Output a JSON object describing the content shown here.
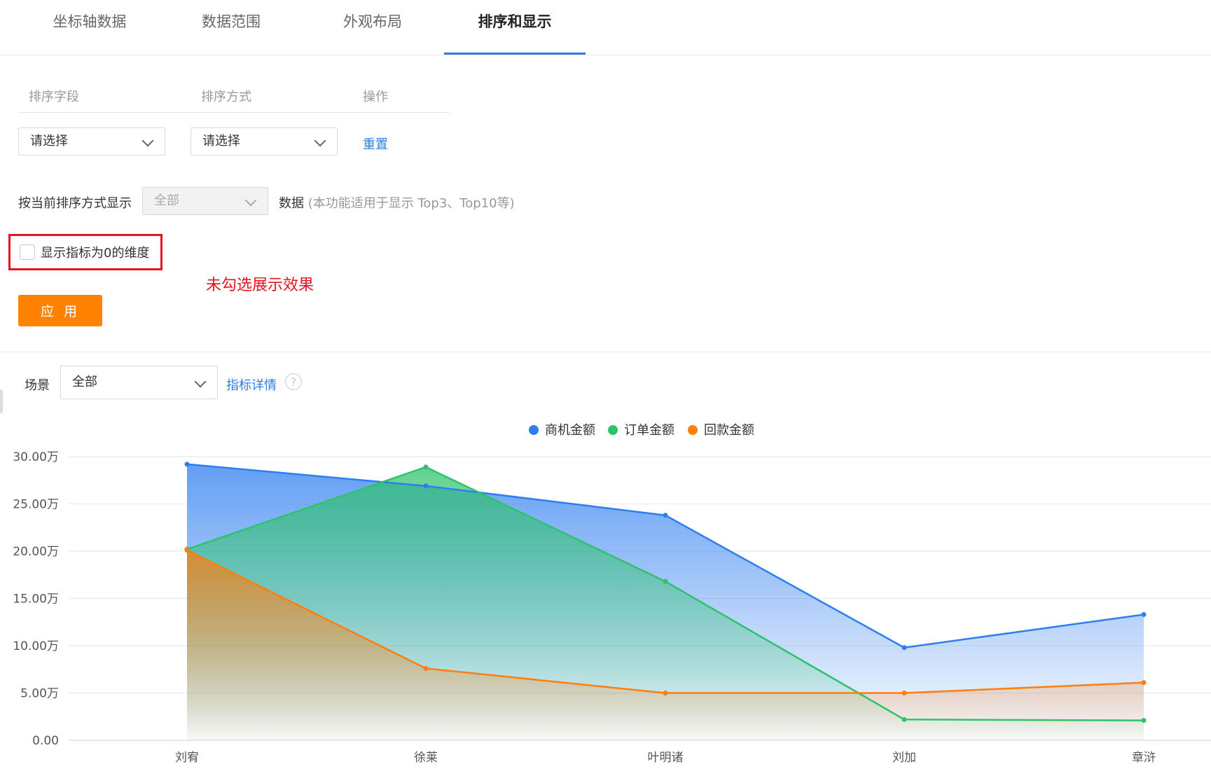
{
  "tabs": [
    {
      "label": "坐标轴数据",
      "active": false
    },
    {
      "label": "数据范围",
      "active": false
    },
    {
      "label": "外观布局",
      "active": false
    },
    {
      "label": "排序和显示",
      "active": true
    }
  ],
  "sort": {
    "headers": {
      "field": "排序字段",
      "method": "排序方式",
      "action": "操作"
    },
    "field_value": "请选择",
    "method_value": "请选择",
    "reset_label": "重置"
  },
  "display": {
    "prefix": "按当前排序方式显示",
    "select_value": "全部",
    "suffix": "数据",
    "hint": "(本功能适用于显示 Top3、Top10等)"
  },
  "zero_dim": {
    "label": "显示指标为0的维度",
    "checked": false
  },
  "annotation": "未勾选展示效果",
  "apply_label": "应 用",
  "scene": {
    "label": "场景",
    "value": "全部",
    "detail_link": "指标详情",
    "help_icon": "?"
  },
  "colors": {
    "blue": "#2f7ef0",
    "green": "#2ec26b",
    "orange": "#ff7e0e",
    "annotation_red": "#e5121f",
    "apply": "#ff8200"
  },
  "chart_data": {
    "type": "area",
    "categories": [
      "刘宥",
      "徐莱",
      "叶明诸",
      "刘加",
      "章浒"
    ],
    "series": [
      {
        "name": "商机金额",
        "color": "#2f7ef0",
        "values": [
          29.2,
          26.9,
          23.8,
          9.8,
          13.3
        ]
      },
      {
        "name": "订单金额",
        "color": "#2ec26b",
        "values": [
          20.2,
          28.9,
          16.8,
          2.2,
          2.1
        ]
      },
      {
        "name": "回款金额",
        "color": "#ff7e0e",
        "values": [
          20.1,
          7.6,
          5.0,
          5.0,
          6.1
        ]
      }
    ],
    "y_ticks": [
      "0.00",
      "5.00万",
      "10.00万",
      "15.00万",
      "20.00万",
      "25.00万",
      "30.00万"
    ],
    "ylim": [
      0,
      30
    ],
    "legend_position": "top-center",
    "grid": true
  }
}
